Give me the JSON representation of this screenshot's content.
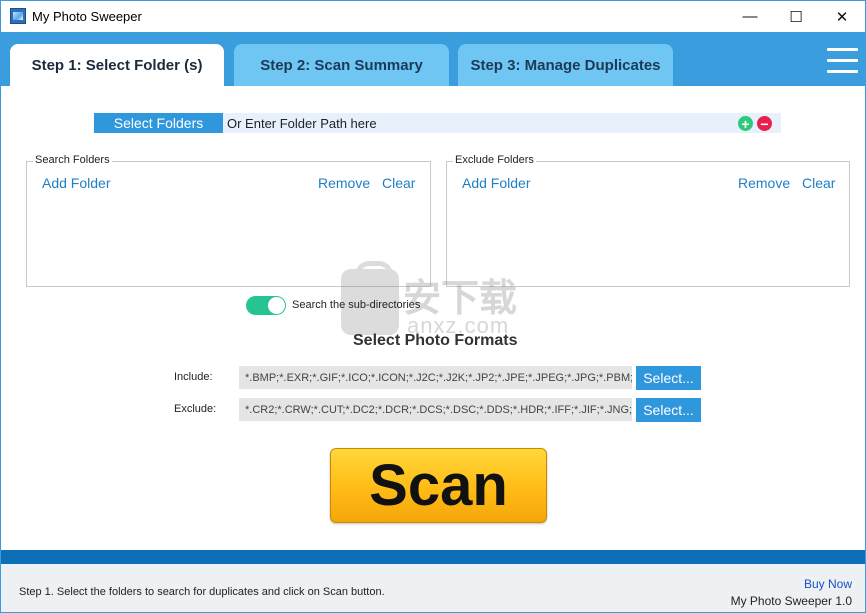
{
  "window": {
    "title": "My Photo Sweeper",
    "controls": {
      "minimize": "—",
      "maximize": "☐",
      "close": "✕"
    }
  },
  "tabs": [
    {
      "label": "Step 1: Select Folder (s)",
      "active": true
    },
    {
      "label": "Step 2: Scan Summary",
      "active": false
    },
    {
      "label": "Step 3: Manage Duplicates",
      "active": false
    }
  ],
  "folder_path": {
    "button_label": "Select Folders",
    "placeholder": "Or Enter Folder Path here",
    "add_symbol": "+",
    "remove_symbol": "−"
  },
  "search_folders": {
    "title": "Search Folders",
    "add_label": "Add Folder",
    "remove_label": "Remove",
    "clear_label": "Clear"
  },
  "exclude_folders": {
    "title": "Exclude Folders",
    "add_label": "Add Folder",
    "remove_label": "Remove",
    "clear_label": "Clear"
  },
  "subdirectories": {
    "label": "Search the sub-directories",
    "enabled": true
  },
  "formats": {
    "title": "Select Photo Formats",
    "include_label": "Include:",
    "include_value": "*.BMP;*.EXR;*.GIF;*.ICO;*.ICON;*.J2C;*.J2K;*.JP2;*.JPE;*.JPEG;*.JPG;*.PBM;*.PGM",
    "exclude_label": "Exclude:",
    "exclude_value": "*.CR2;*.CRW;*.CUT;*.DC2;*.DCR;*.DCS;*.DSC;*.DDS;*.HDR;*.IFF;*.JIF;*.JNG;*.",
    "select_label": "Select..."
  },
  "scan_label": "Scan",
  "status": {
    "message": "Step 1. Select the folders to search for duplicates and click on Scan button.",
    "buy_now": "Buy Now",
    "version": "My Photo Sweeper 1.0"
  },
  "watermark": {
    "text": "安下载",
    "sub": "anxz.com"
  },
  "colors": {
    "accent": "#3a9ddd",
    "tab_inactive": "#6fc6f3",
    "button_blue": "#2f97dc",
    "toggle_on": "#26c493",
    "scan_yellow": "#ffbb16"
  }
}
